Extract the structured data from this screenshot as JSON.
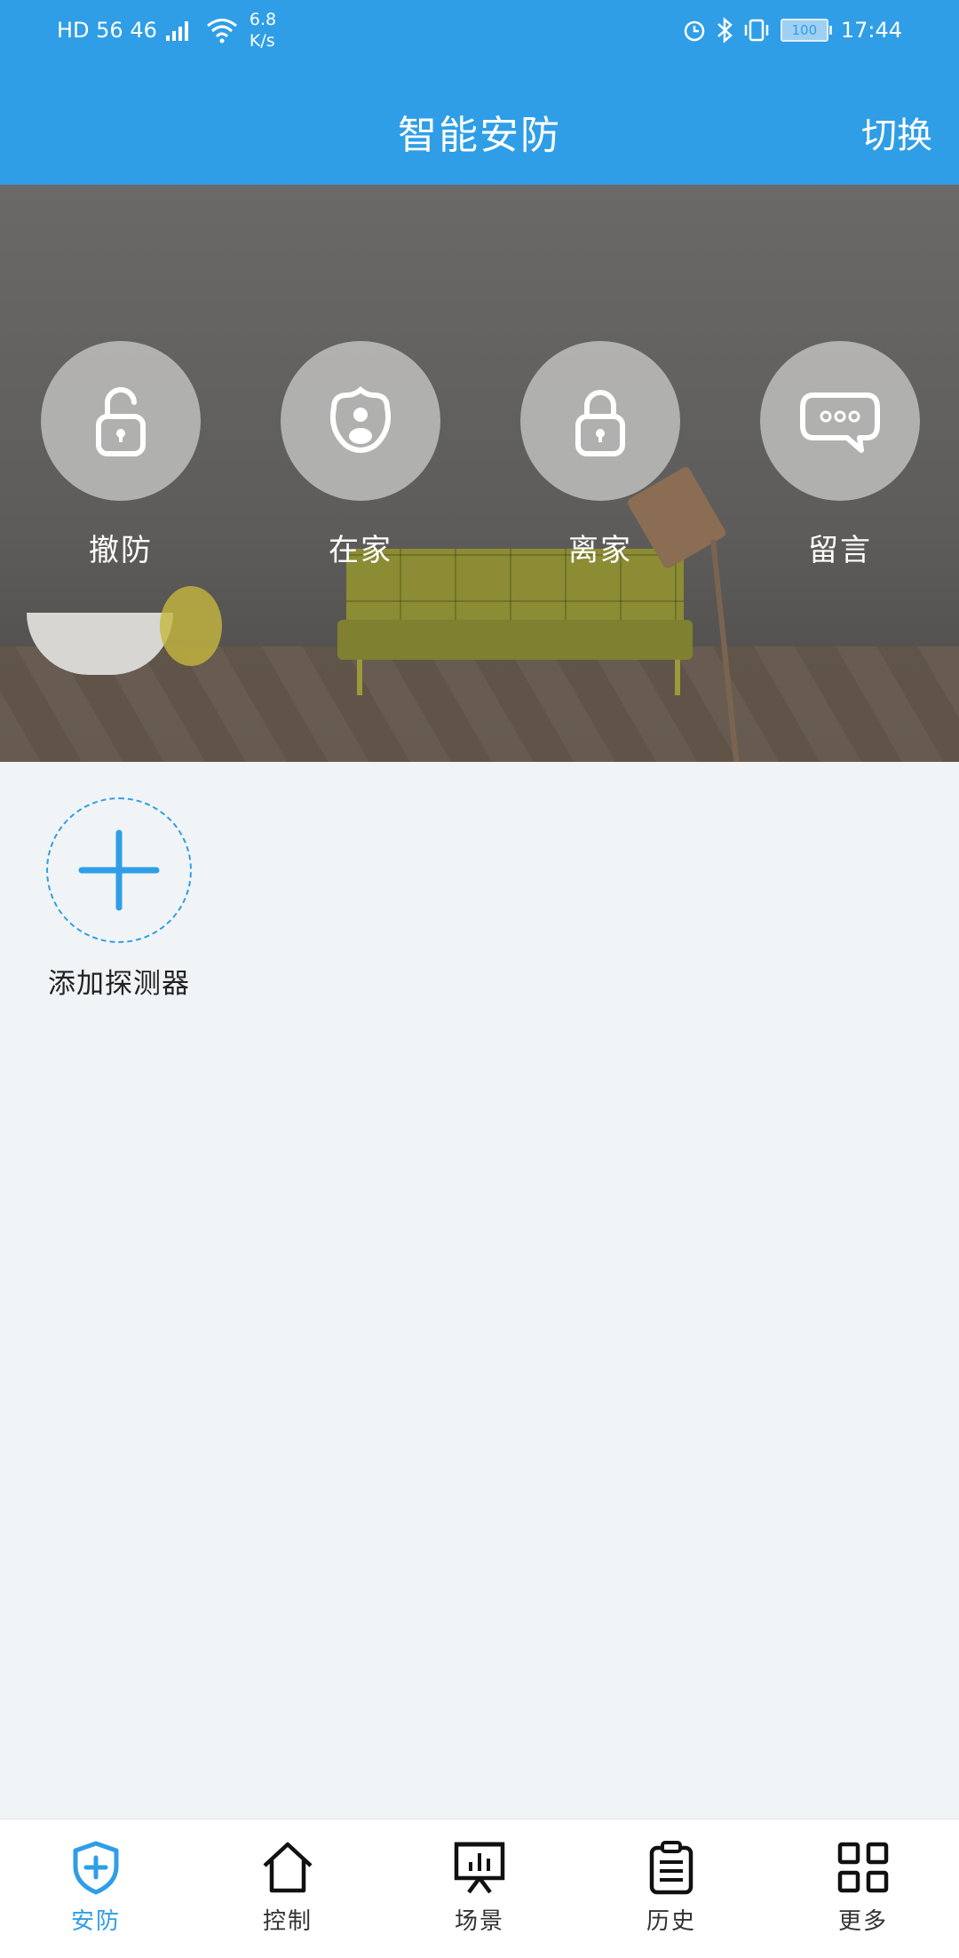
{
  "status_bar": {
    "network_left": "HD 56 46",
    "speed_value": "6.8",
    "speed_unit": "K/s",
    "battery": "100",
    "time": "17:44"
  },
  "header": {
    "title": "智能安防",
    "switch_label": "切换"
  },
  "modes": [
    {
      "label": "撤防",
      "icon": "unlock-icon"
    },
    {
      "label": "在家",
      "icon": "home-person-icon"
    },
    {
      "label": "离家",
      "icon": "lock-icon"
    },
    {
      "label": "留言",
      "icon": "message-icon"
    }
  ],
  "add_detector": {
    "label": "添加探测器",
    "icon": "plus-icon"
  },
  "tabs": [
    {
      "label": "安防",
      "icon": "shield-plus-icon",
      "active": true
    },
    {
      "label": "控制",
      "icon": "house-icon",
      "active": false
    },
    {
      "label": "场景",
      "icon": "presentation-chart-icon",
      "active": false
    },
    {
      "label": "历史",
      "icon": "clipboard-icon",
      "active": false
    },
    {
      "label": "更多",
      "icon": "grid-icon",
      "active": false
    }
  ],
  "colors": {
    "primary": "#2f9ee6",
    "background": "#f1f4f7",
    "tab_inactive": "#333333"
  }
}
